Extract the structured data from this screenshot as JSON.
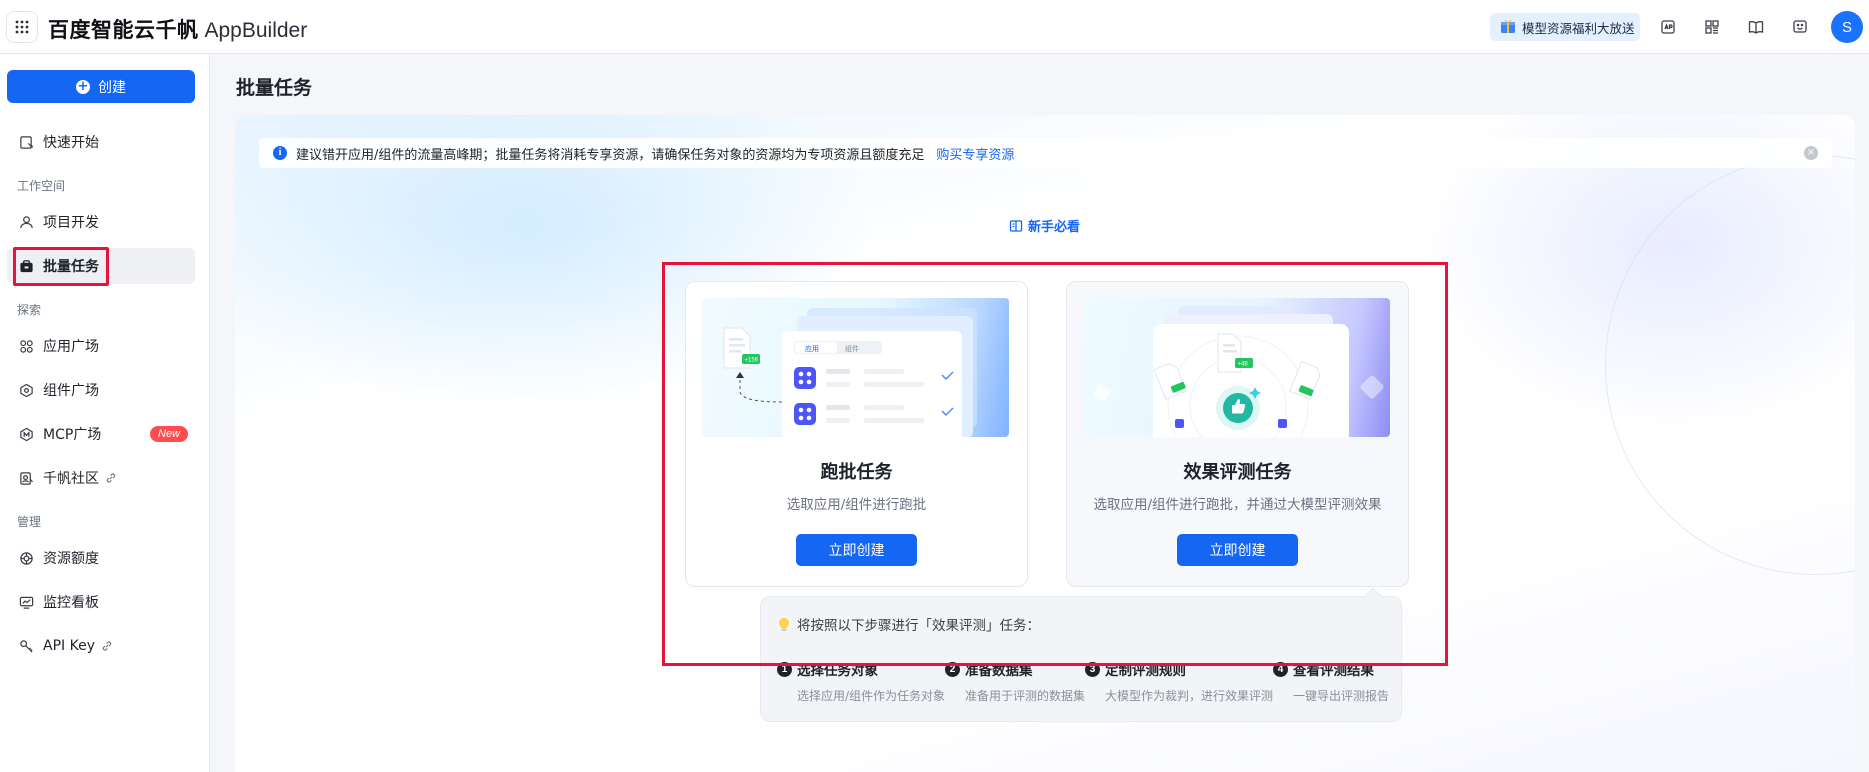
{
  "header": {
    "brand_cn": "百度智能云千帆",
    "brand_en": "AppBuilder",
    "promo_label": "模型资源福利大放送",
    "avatar_letter": "S",
    "icons": [
      "api-icon",
      "grid-icon",
      "book-icon",
      "feedback-icon"
    ]
  },
  "sidebar": {
    "create_label": "创建",
    "quick_start": "快速开始",
    "sections": {
      "workspace": "工作空间",
      "explore": "探索",
      "manage": "管理"
    },
    "items": {
      "project_dev": "项目开发",
      "batch_task": "批量任务",
      "app_square": "应用广场",
      "component_square": "组件广场",
      "mcp_square": "MCP广场",
      "mcp_badge": "New",
      "community": "千帆社区",
      "resource_quota": "资源额度",
      "monitor": "监控看板",
      "api_key": "API Key"
    },
    "active_item": "批量任务"
  },
  "main": {
    "page_title": "批量任务",
    "notice": {
      "text": "建议错开应用/组件的流量高峰期；批量任务将消耗专享资源，请确保任务对象的资源均为专项资源且额度充足",
      "link": "购买专享资源"
    },
    "guide_link": "新手必看",
    "cards": [
      {
        "title": "跑批任务",
        "desc": "选取应用/组件进行跑批",
        "button": "立即创建",
        "illus_tab_active": "应用",
        "illus_tab_inactive": "组件",
        "illus_badge": "+156"
      },
      {
        "title": "效果评测任务",
        "desc": "选取应用/组件进行跑批，并通过大模型评测效果",
        "button": "立即创建",
        "illus_badge": "+48"
      }
    ],
    "steps": {
      "title": "将按照以下步骤进行「效果评测」任务：",
      "items": [
        {
          "num": "1",
          "title": "选择任务对象",
          "desc": "选择应用/组件作为任务对象"
        },
        {
          "num": "2",
          "title": "准备数据集",
          "desc": "准备用于评测的数据集"
        },
        {
          "num": "3",
          "title": "定制评测规则",
          "desc": "大模型作为裁判，进行效果评测"
        },
        {
          "num": "4",
          "title": "查看评测结果",
          "desc": "一键导出评测报告"
        }
      ]
    }
  },
  "colors": {
    "primary": "#1666f4",
    "highlight": "#e6133b",
    "badge_new": "#ff4d4f"
  }
}
